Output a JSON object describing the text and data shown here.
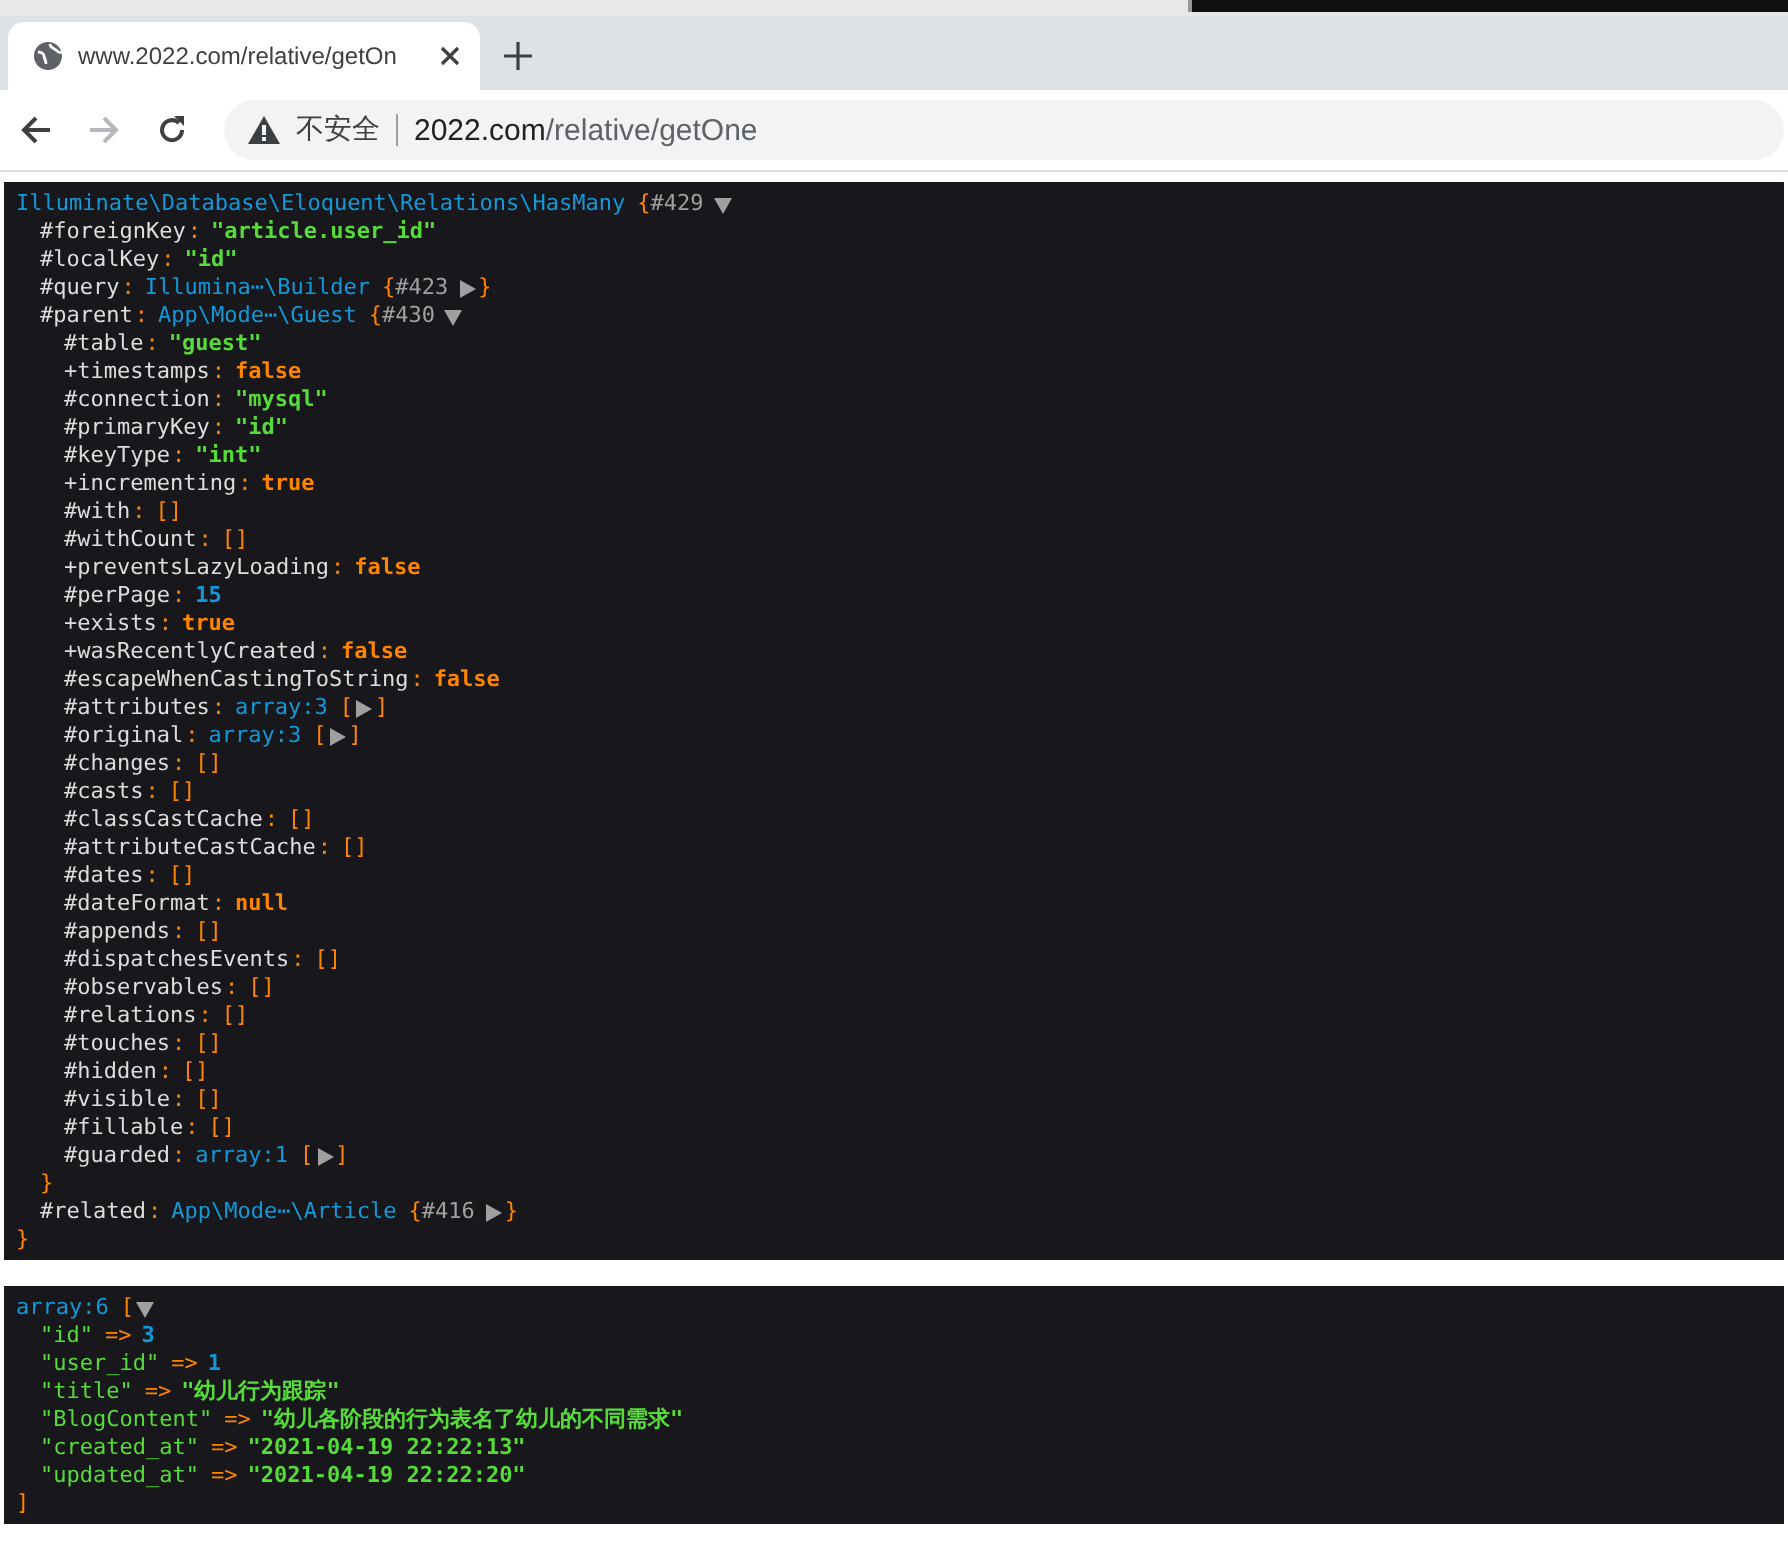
{
  "browser": {
    "tabs": [
      {
        "title": "www.2022.com/relative/getOn",
        "selected": true
      }
    ],
    "nav": [
      {
        "kind": "back",
        "disabled": false
      },
      {
        "kind": "forward",
        "disabled": true
      },
      {
        "kind": "reload",
        "disabled": false
      }
    ],
    "address": {
      "security": "不安全",
      "host": "2022.com",
      "path": "/relative/getOne"
    }
  },
  "dumps": [
    {
      "value": {
        "kind": "object",
        "class": "Illuminate\\Database\\Eloquent\\Relations\\HasMany",
        "open": "{",
        "ref": "#429",
        "expanded": true,
        "close": "}",
        "children": [
          {
            "key": "#foreignKey",
            "sep": ":",
            "value": {
              "kind": "string",
              "text": "\"article.user_id\""
            }
          },
          {
            "key": "#localKey",
            "sep": ":",
            "value": {
              "kind": "string",
              "text": "\"id\""
            }
          },
          {
            "key": "#query",
            "sep": ":",
            "value": {
              "kind": "object",
              "class": "Illumina⋯\\Builder",
              "open": "{",
              "ref": "#423",
              "expanded": false,
              "close": "}"
            }
          },
          {
            "key": "#parent",
            "sep": ":",
            "value": {
              "kind": "object",
              "class": "App\\Mode⋯\\Guest",
              "open": "{",
              "ref": "#430",
              "expanded": true,
              "close": "}",
              "children": [
                {
                  "key": "#table",
                  "sep": ":",
                  "value": {
                    "kind": "string",
                    "text": "\"guest\""
                  }
                },
                {
                  "key": "+timestamps",
                  "sep": ":",
                  "value": {
                    "kind": "bool",
                    "text": "false"
                  }
                },
                {
                  "key": "#connection",
                  "sep": ":",
                  "value": {
                    "kind": "string",
                    "text": "\"mysql\""
                  }
                },
                {
                  "key": "#primaryKey",
                  "sep": ":",
                  "value": {
                    "kind": "string",
                    "text": "\"id\""
                  }
                },
                {
                  "key": "#keyType",
                  "sep": ":",
                  "value": {
                    "kind": "string",
                    "text": "\"int\""
                  }
                },
                {
                  "key": "+incrementing",
                  "sep": ":",
                  "value": {
                    "kind": "bool",
                    "text": "true"
                  }
                },
                {
                  "key": "#with",
                  "sep": ":",
                  "value": {
                    "kind": "empty",
                    "text": "[]"
                  }
                },
                {
                  "key": "#withCount",
                  "sep": ":",
                  "value": {
                    "kind": "empty",
                    "text": "[]"
                  }
                },
                {
                  "key": "+preventsLazyLoading",
                  "sep": ":",
                  "value": {
                    "kind": "bool",
                    "text": "false"
                  }
                },
                {
                  "key": "#perPage",
                  "sep": ":",
                  "value": {
                    "kind": "num",
                    "text": "15"
                  }
                },
                {
                  "key": "+exists",
                  "sep": ":",
                  "value": {
                    "kind": "bool",
                    "text": "true"
                  }
                },
                {
                  "key": "+wasRecentlyCreated",
                  "sep": ":",
                  "value": {
                    "kind": "bool",
                    "text": "false"
                  }
                },
                {
                  "key": "#escapeWhenCastingToString",
                  "sep": ":",
                  "value": {
                    "kind": "bool",
                    "text": "false"
                  }
                },
                {
                  "key": "#attributes",
                  "sep": ":",
                  "value": {
                    "kind": "array",
                    "label": "array:3",
                    "open": "[",
                    "expanded": false,
                    "close": "]"
                  }
                },
                {
                  "key": "#original",
                  "sep": ":",
                  "value": {
                    "kind": "array",
                    "label": "array:3",
                    "open": "[",
                    "expanded": false,
                    "close": "]"
                  }
                },
                {
                  "key": "#changes",
                  "sep": ":",
                  "value": {
                    "kind": "empty",
                    "text": "[]"
                  }
                },
                {
                  "key": "#casts",
                  "sep": ":",
                  "value": {
                    "kind": "empty",
                    "text": "[]"
                  }
                },
                {
                  "key": "#classCastCache",
                  "sep": ":",
                  "value": {
                    "kind": "empty",
                    "text": "[]"
                  }
                },
                {
                  "key": "#attributeCastCache",
                  "sep": ":",
                  "value": {
                    "kind": "empty",
                    "text": "[]"
                  }
                },
                {
                  "key": "#dates",
                  "sep": ":",
                  "value": {
                    "kind": "empty",
                    "text": "[]"
                  }
                },
                {
                  "key": "#dateFormat",
                  "sep": ":",
                  "value": {
                    "kind": "null",
                    "text": "null"
                  }
                },
                {
                  "key": "#appends",
                  "sep": ":",
                  "value": {
                    "kind": "empty",
                    "text": "[]"
                  }
                },
                {
                  "key": "#dispatchesEvents",
                  "sep": ":",
                  "value": {
                    "kind": "empty",
                    "text": "[]"
                  }
                },
                {
                  "key": "#observables",
                  "sep": ":",
                  "value": {
                    "kind": "empty",
                    "text": "[]"
                  }
                },
                {
                  "key": "#relations",
                  "sep": ":",
                  "value": {
                    "kind": "empty",
                    "text": "[]"
                  }
                },
                {
                  "key": "#touches",
                  "sep": ":",
                  "value": {
                    "kind": "empty",
                    "text": "[]"
                  }
                },
                {
                  "key": "#hidden",
                  "sep": ":",
                  "value": {
                    "kind": "empty",
                    "text": "[]"
                  }
                },
                {
                  "key": "#visible",
                  "sep": ":",
                  "value": {
                    "kind": "empty",
                    "text": "[]"
                  }
                },
                {
                  "key": "#fillable",
                  "sep": ":",
                  "value": {
                    "kind": "empty",
                    "text": "[]"
                  }
                },
                {
                  "key": "#guarded",
                  "sep": ":",
                  "value": {
                    "kind": "array",
                    "label": "array:1",
                    "open": "[",
                    "expanded": false,
                    "close": "]"
                  }
                }
              ]
            }
          },
          {
            "key": "#related",
            "sep": ":",
            "value": {
              "kind": "object",
              "class": "App\\Mode⋯\\Article",
              "open": "{",
              "ref": "#416",
              "expanded": false,
              "close": "}"
            }
          }
        ]
      }
    },
    {
      "value": {
        "kind": "array",
        "label": "array:6",
        "open": "[",
        "expanded": true,
        "close": "]",
        "children": [
          {
            "key": "\"id\"",
            "sep": "=>",
            "value": {
              "kind": "num",
              "text": "3"
            }
          },
          {
            "key": "\"user_id\"",
            "sep": "=>",
            "value": {
              "kind": "num",
              "text": "1"
            }
          },
          {
            "key": "\"title\"",
            "sep": "=>",
            "value": {
              "kind": "string",
              "text": "\"幼儿行为跟踪\""
            }
          },
          {
            "key": "\"BlogContent\"",
            "sep": "=>",
            "value": {
              "kind": "string",
              "text": "\"幼儿各阶段的行为表名了幼儿的不同需求\""
            }
          },
          {
            "key": "\"created_at\"",
            "sep": "=>",
            "value": {
              "kind": "string",
              "text": "\"2021-04-19 22:22:13\""
            }
          },
          {
            "key": "\"updated_at\"",
            "sep": "=>",
            "value": {
              "kind": "string",
              "text": "\"2021-04-19 22:22:20\""
            }
          }
        ]
      }
    }
  ]
}
